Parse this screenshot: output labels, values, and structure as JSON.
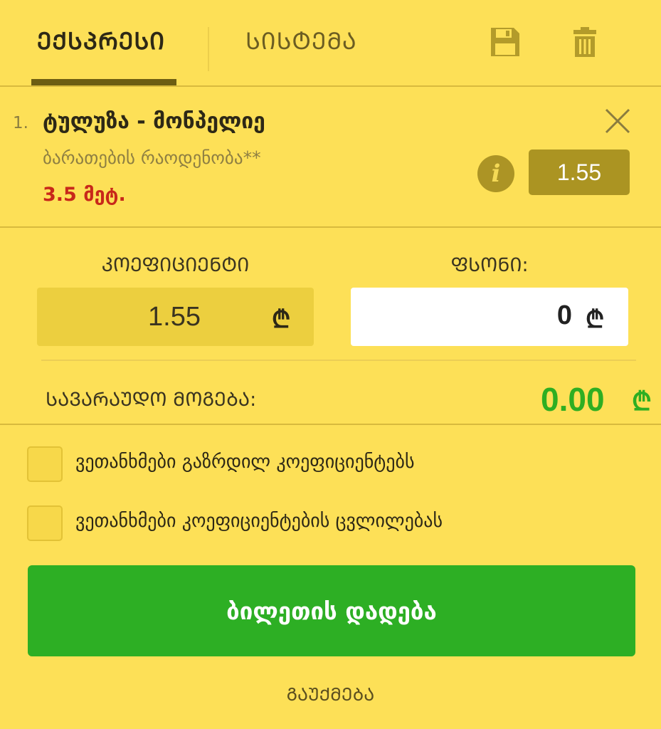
{
  "tabs": [
    {
      "label": "ᲔᲥᲡᲞᲠᲔᲡᲘ",
      "active": true
    },
    {
      "label": "ᲡᲘᲡᲢᲔᲛᲐ",
      "active": false
    }
  ],
  "icons": {
    "save": "save-icon",
    "trash": "trash-icon",
    "close": "close-icon",
    "info": "info-icon"
  },
  "selection": {
    "number": "1.",
    "match": "ტულუზა - მონპელიე",
    "market": "ბარათების რაოდენობა**",
    "outcome": "3.5 მეტ.",
    "odds": "1.55",
    "info_glyph": "i"
  },
  "coefficient": {
    "label": "ᲙᲝᲔᲤᲘᲪᲘᲔᲜᲢᲘ",
    "value": "1.55",
    "currency": "₾"
  },
  "stake": {
    "label": "ᲤᲡᲝᲜᲘ:",
    "value": "0",
    "currency": "₾"
  },
  "potential_win": {
    "label": "ᲡᲐᲕᲐᲠᲐᲣᲓᲝ ᲛᲝᲒᲔᲑᲐ:",
    "value": "0.00",
    "currency": "₾"
  },
  "checkboxes": [
    {
      "label": "ვეთანხმები გაზრდილ კოეფიციენტებს",
      "checked": false
    },
    {
      "label": "ვეთანხმები კოეფიციენტების ცვლილებას",
      "checked": false
    }
  ],
  "actions": {
    "place_bet": "ბილეთის დადება",
    "cancel": "ᲒᲐᲣᲥᲛᲔᲑᲐ"
  },
  "colors": {
    "background": "#fde057",
    "accent_dark": "#ab9422",
    "win_green": "#2eae22",
    "outcome_red": "#c8281a",
    "button_green": "#2daf24"
  }
}
